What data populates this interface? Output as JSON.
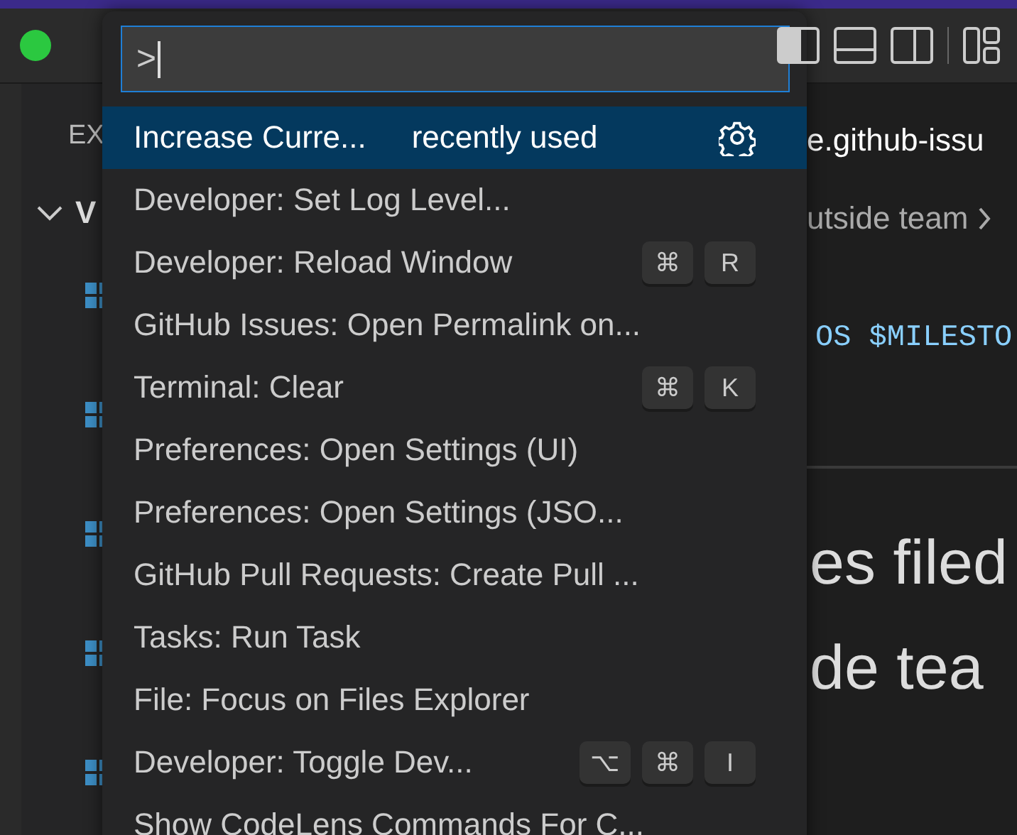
{
  "sidebar": {
    "header": "EX",
    "section": "V"
  },
  "editor": {
    "tab": "e.github-issu",
    "breadcrumb": "utside team",
    "code": "OS $MILESTO",
    "heading_lines": [
      "es filed",
      "de tea"
    ]
  },
  "palette": {
    "input": {
      "value": ">"
    },
    "items": [
      {
        "label": "Increase Curre...",
        "detail": "recently used",
        "selected": true
      },
      {
        "label": "Developer: Set Log Level...",
        "selected": false
      },
      {
        "label": "Developer: Reload Window",
        "keys": [
          "⌘",
          "R"
        ],
        "selected": false
      },
      {
        "label": "GitHub Issues: Open Permalink on...",
        "selected": false
      },
      {
        "label": "Terminal: Clear",
        "keys": [
          "⌘",
          "K"
        ],
        "selected": false
      },
      {
        "label": "Preferences: Open Settings (UI)",
        "selected": false
      },
      {
        "label": "Preferences: Open Settings (JSO...",
        "selected": false
      },
      {
        "label": "GitHub Pull Requests: Create Pull ...",
        "selected": false
      },
      {
        "label": "Tasks: Run Task",
        "selected": false
      },
      {
        "label": "File: Focus on Files Explorer",
        "selected": false
      },
      {
        "label": "Developer: Toggle Dev...",
        "keys": [
          "⌥",
          "⌘",
          "I"
        ],
        "selected": false
      },
      {
        "label": "Show CodeLens Commands For C...",
        "selected": false
      }
    ]
  }
}
